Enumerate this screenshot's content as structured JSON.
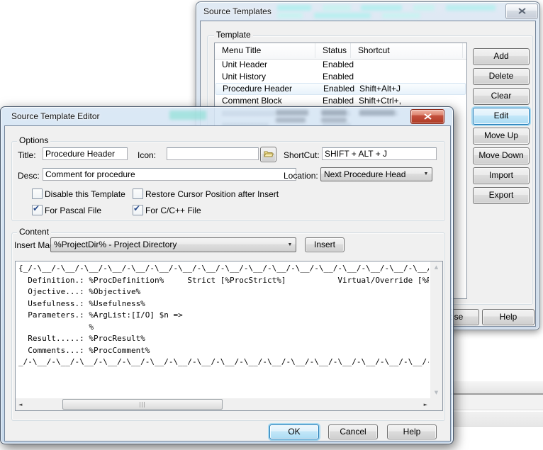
{
  "colors": {
    "dialog_face": "#f0f0f0",
    "focus_glow": "#6dc7f0",
    "selection_row": "#e7f2fb",
    "glass_active": "#c9ddf0",
    "code_highlight": "#aef0ee"
  },
  "icons": {
    "check": "✔",
    "dropdown_arrow": "▼",
    "scroll_up": "▲",
    "scroll_down": "▼",
    "scroll_left": "◄",
    "scroll_right": "►"
  },
  "templates_dialog": {
    "title": "Source Templates",
    "group_label": "Template",
    "list": {
      "columns": [
        "Menu Title",
        "Status",
        "Shortcut"
      ],
      "rows": [
        {
          "menu_title": "Unit Header",
          "status": "Enabled",
          "shortcut": "",
          "selected": false
        },
        {
          "menu_title": "Unit History",
          "status": "Enabled",
          "shortcut": "",
          "selected": false
        },
        {
          "menu_title": "Procedure Header",
          "status": "Enabled",
          "shortcut": "Shift+Alt+J",
          "selected": true
        },
        {
          "menu_title": "Comment Block",
          "status": "Enabled",
          "shortcut": "Shift+Ctrl+,",
          "selected": false
        }
      ]
    },
    "buttons": [
      "Add",
      "Delete",
      "Clear",
      "Edit",
      "Move Up",
      "Move Down",
      "Import",
      "Export"
    ],
    "bottom_buttons": [
      "Close",
      "Help"
    ]
  },
  "editor_dialog": {
    "title": "Source Template Editor",
    "options": {
      "label": "Options",
      "title_label": "Title:",
      "title_value": "Procedure Header",
      "icon_label": "Icon:",
      "icon_value": "",
      "shortcut_label": "ShortCut:",
      "shortcut_value": "SHIFT + ALT + J",
      "desc_label": "Desc:",
      "desc_value": "Comment for procedure",
      "location_label": "Location:",
      "location_value": "Next Procedure Head",
      "checkboxes": [
        {
          "label": "Disable this Template",
          "checked": false
        },
        {
          "label": "Restore Cursor Position after Insert",
          "checked": false
        },
        {
          "label": "For Pascal File",
          "checked": true
        },
        {
          "label": "For C/C++ File",
          "checked": true
        }
      ]
    },
    "content": {
      "label": "Content",
      "insert_macro_label": "Insert Macro:",
      "insert_macro_value": "%ProjectDir% - Project Directory",
      "insert_button": "Insert",
      "template_text": "{_/-\\__/-\\__/-\\__/-\\__/-\\__/-\\__/-\\__/-\\__/-\\__/-\\__/-\\__/-\\__/-\\__/-\\__/-\\__/-\\__/-\\__/-\\__/-\\_\n  Definition.: %ProcDefinition%     Strict [%ProcStrict%]           Virtual/Override [%ProcVirtual%]\n  Ojective...: %Objective%\n  Usefulness.: %Usefulness%\n  Parameters.: %ArgList:[I/O] $n =>\n               %\n  Result.....: %ProcResult%\n  Comments...: %ProcComment%\n_/-\\__/-\\__/-\\__/-\\__/-\\__/-\\__/-\\__/-\\__/-\\__/-\\__/-\\__/-\\__/-\\__/-\\__/-\\__/-\\__/-\\__/-\\__/-\\_"
    },
    "bottom_buttons": [
      "OK",
      "Cancel",
      "Help"
    ]
  }
}
